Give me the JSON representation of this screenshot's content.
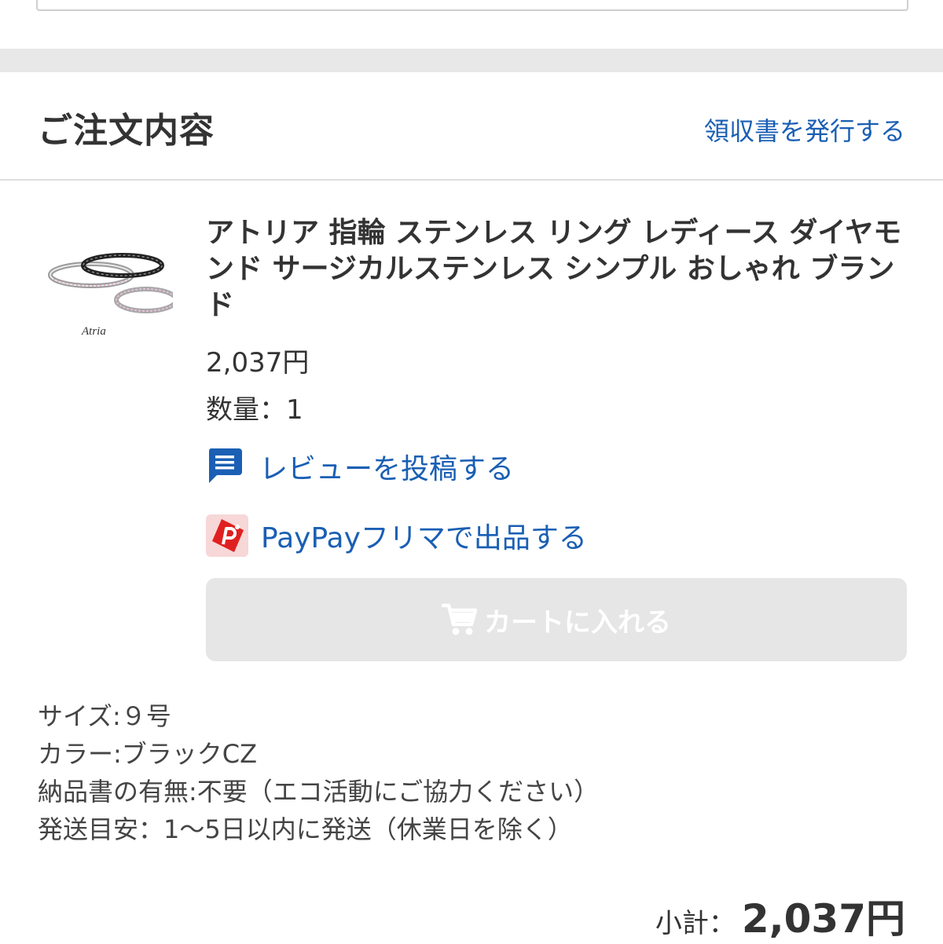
{
  "section": {
    "title": "ご注文内容",
    "receipt_link": "領収書を発行する"
  },
  "item": {
    "title": "アトリア 指輪 ステンレス リング レディース ダイヤモンド サージカルステンレス シンプル おしゃれ ブランド",
    "thumbnail_brand": "Atria",
    "price": "2,037円",
    "quantity": "数量：1",
    "review_link": "レビューを投稿する",
    "flea_link": "PayPayフリマで出品する",
    "cart_button": "カートに入れる",
    "options": [
      "サイズ:９号",
      "カラー:ブラックCZ",
      "納品書の有無:不要（エコ活動にご協力ください）",
      "発送目安：1〜5日以内に発送（休業日を除く）"
    ]
  },
  "subtotal": {
    "label": "小計：",
    "value": "2,037円"
  },
  "colors": {
    "link": "#1a5fb4",
    "disabled_button": "#e6e6e6",
    "flea_brand": "#e02020"
  },
  "icons": {
    "review": "comment-icon",
    "flea": "paypay-flea-icon",
    "cart": "cart-icon"
  }
}
